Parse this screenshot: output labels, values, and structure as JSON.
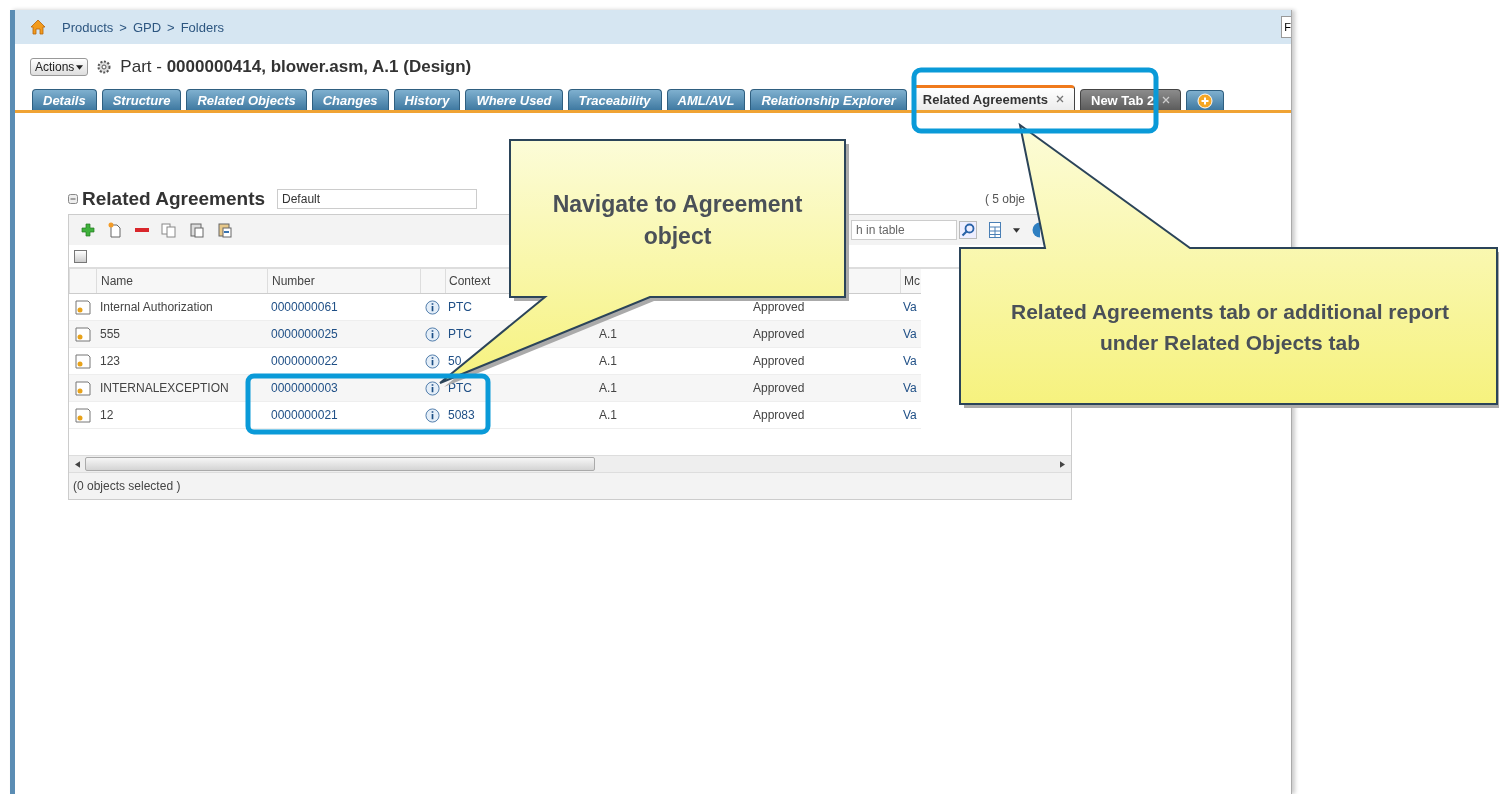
{
  "breadcrumb": {
    "items": [
      "Products",
      "GPD",
      "Folders"
    ],
    "separator": ">"
  },
  "corner_button": {
    "label": "F"
  },
  "header": {
    "actions_label": "Actions",
    "title": "Part - **0000000414, blower.asm, A.1 (Design)**"
  },
  "tabs": [
    {
      "label": "Details",
      "selected": false,
      "kind": "object",
      "closable": false
    },
    {
      "label": "Structure",
      "selected": false,
      "kind": "object",
      "closable": false
    },
    {
      "label": "Related Objects",
      "selected": false,
      "kind": "object",
      "closable": false
    },
    {
      "label": "Changes",
      "selected": false,
      "kind": "object",
      "closable": false
    },
    {
      "label": "History",
      "selected": false,
      "kind": "object",
      "closable": false
    },
    {
      "label": "Where Used",
      "selected": false,
      "kind": "object",
      "closable": false
    },
    {
      "label": "Traceability",
      "selected": false,
      "kind": "object",
      "closable": false
    },
    {
      "label": "AML/AVL",
      "selected": false,
      "kind": "object",
      "closable": false
    },
    {
      "label": "Relationship Explorer",
      "selected": false,
      "kind": "object",
      "closable": false
    },
    {
      "label": "Related Agreements",
      "selected": true,
      "kind": "user",
      "closable": true
    },
    {
      "label": "New Tab 2",
      "selected": false,
      "kind": "user",
      "closable": true
    }
  ],
  "panel": {
    "title": "Related Agreements",
    "view": "Default",
    "count": "( 5 obje",
    "search": {
      "placeholder": "h in table"
    },
    "select_all": {
      "checked": false
    },
    "columns": [
      "Name",
      "Number",
      "Context",
      "Mc"
    ],
    "rows": [
      {
        "name": "Internal Authorization",
        "number": "0000000061",
        "context": "PTC",
        "revision": null,
        "state": "Approved",
        "column_7": "Va"
      },
      {
        "name": "555",
        "number": "0000000025",
        "context": "PTC",
        "revision": "A.1",
        "state": "Approved",
        "column_7": "Va"
      },
      {
        "name": "123",
        "number": "0000000022",
        "context": "50",
        "revision": "A.1",
        "state": "Approved",
        "column_7": "Va"
      },
      {
        "name": "INTERNALEXCEPTION",
        "number": "0000000003",
        "context": "PTC",
        "revision": "A.1",
        "state": "Approved",
        "column_7": "Va"
      },
      {
        "name": "12",
        "number": "0000000021",
        "context": "5083",
        "revision": "A.1",
        "state": "Approved",
        "column_7": "Va"
      }
    ],
    "footer": "(0 objects selected )"
  },
  "callouts": [
    {
      "text": "Navigate to Agreement object"
    },
    {
      "text": "Related Agreements tab or additional report under Related Objects tab"
    }
  ]
}
